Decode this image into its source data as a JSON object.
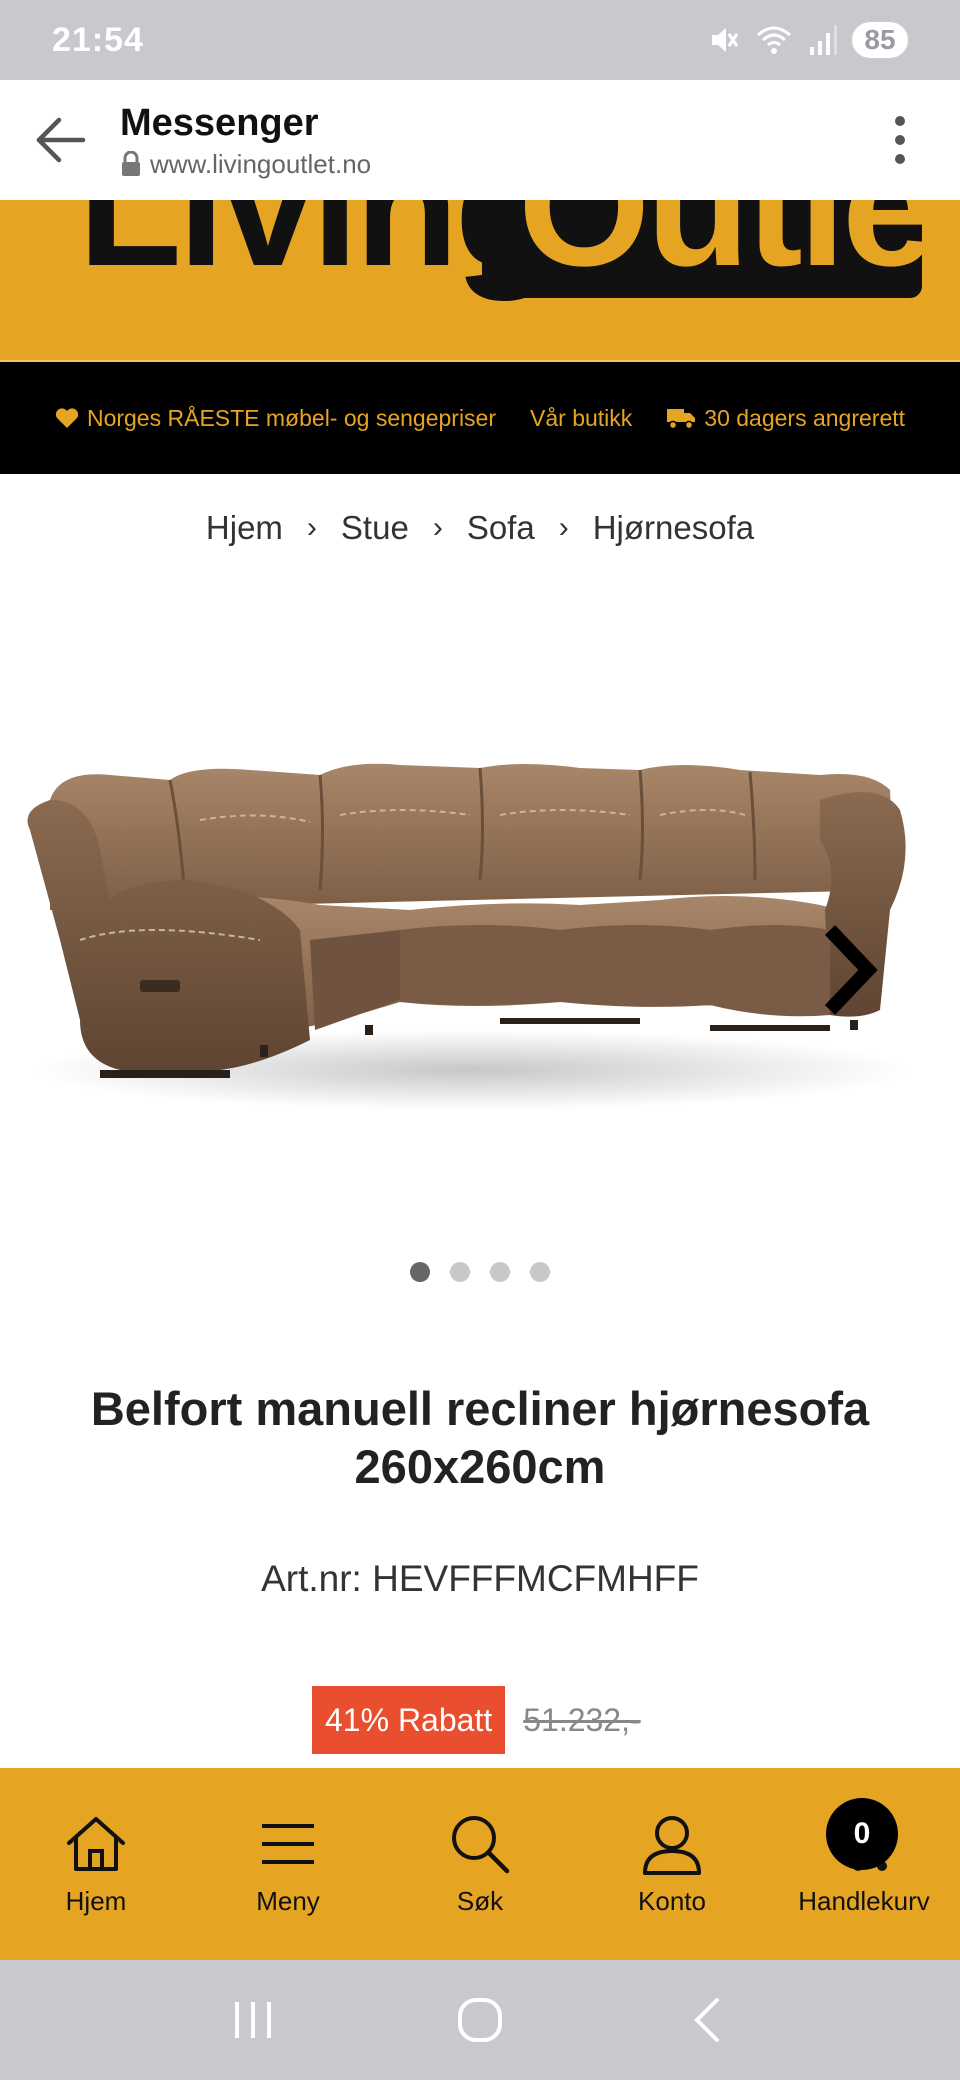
{
  "status_bar": {
    "time": "21:54",
    "battery": "85"
  },
  "browser_header": {
    "title": "Messenger",
    "url": "www.livingoutlet.no"
  },
  "logo": {
    "word_left": "Living",
    "word_right": "Outlet",
    "colors": {
      "brand_yellow": "#e6a423",
      "brand_black": "#111111"
    }
  },
  "promo_bar": {
    "item1": "Norges RÅESTE møbel- og sengepriser",
    "item2": "Vår butikk",
    "item3": "30 dagers angrerett"
  },
  "breadcrumb": {
    "items": [
      "Hjem",
      "Stue",
      "Sofa",
      "Hjørnesofa"
    ],
    "separator": "›"
  },
  "gallery": {
    "image_icon": "sofa-image",
    "dot_count": 4,
    "active_index": 0
  },
  "product": {
    "title": "Belfort manuell recliner hjørnesofa 260x260cm",
    "art_nr": "Art.nr: HEVFFFMCFMHFF",
    "discount": "41% Rabatt",
    "old_price": "51.232,-"
  },
  "bottom_nav": {
    "home": "Hjem",
    "menu": "Meny",
    "search": "Søk",
    "account": "Konto",
    "cart": "Handlekurv",
    "cart_count": "0"
  },
  "colors": {
    "discount_red": "#e94e2f",
    "system_gray": "#c8c9ce"
  }
}
